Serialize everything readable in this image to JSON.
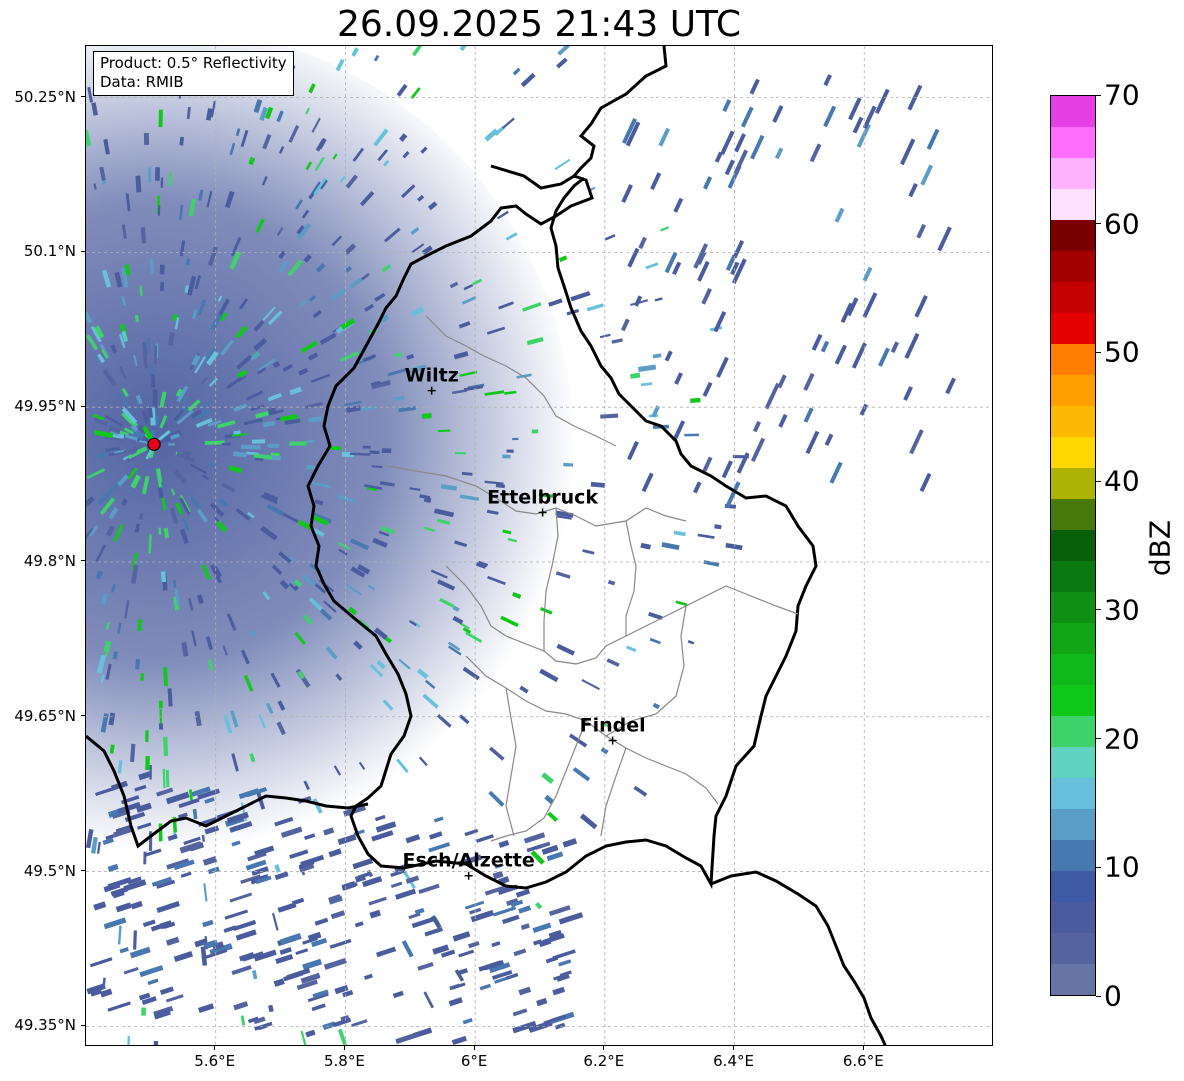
{
  "title": "26.09.2025 21:43 UTC",
  "info": {
    "product": "Product: 0.5° Reflectivity",
    "data_source": "Data: RMIB"
  },
  "map": {
    "lon_range": [
      5.4,
      6.8
    ],
    "lat_range": [
      49.33,
      50.3
    ],
    "grid": true,
    "radar_site": {
      "lon": 5.505,
      "lat": 49.914,
      "color": "#e8001c"
    },
    "cities": [
      {
        "name": "Wiltz",
        "lon": 5.933,
        "lat": 49.966
      },
      {
        "name": "Ettelbruck",
        "lon": 6.104,
        "lat": 49.848
      },
      {
        "name": "Findel",
        "lon": 6.212,
        "lat": 49.627
      },
      {
        "name": "Esch/Alzette",
        "lon": 5.99,
        "lat": 49.496
      }
    ],
    "x_ticks": [
      "5.6°E",
      "5.8°E",
      "6°E",
      "6.2°E",
      "6.4°E",
      "6.6°E"
    ],
    "y_ticks": [
      "50.25°N",
      "50.1°N",
      "49.95°N",
      "49.8°N",
      "49.65°N",
      "49.5°N",
      "49.35°N"
    ]
  },
  "colorbar": {
    "label": "dBZ",
    "ticks": [
      "0",
      "10",
      "20",
      "30",
      "40",
      "50",
      "60",
      "70"
    ],
    "colors": [
      "#6674a6",
      "#5563a0",
      "#4a5c9e",
      "#3e5aa4",
      "#4778b0",
      "#5a9dc6",
      "#68c1dc",
      "#5fd3c0",
      "#3dd36a",
      "#10c81a",
      "#0fb81b",
      "#11a616",
      "#0e9113",
      "#0a7a10",
      "#075f0a",
      "#477a0a",
      "#adb406",
      "#ffd700",
      "#fdb804",
      "#ffa000",
      "#ff7d00",
      "#e40000",
      "#c40000",
      "#a50000",
      "#7a0000",
      "#ffe1ff",
      "#ffb3ff",
      "#ff6eff",
      "#e63fe6"
    ]
  }
}
